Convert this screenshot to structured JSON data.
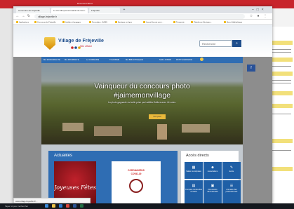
{
  "background_window": {
    "title": "Document Word",
    "side_snippets": [
      "Ensemble valorisons"
    ]
  },
  "taskbar": {
    "search_placeholder": "Taper ici pour rechercher"
  },
  "browser": {
    "tabs": [
      {
        "label": "Commune de Fréjeville"
      },
      {
        "label": "Le CC DE (Communauté de Com..."
      },
      {
        "label": "Fréjeville"
      }
    ],
    "url": "village-frejeville.fr",
    "bookmarks": [
      "Applications",
      "Commune de Fréjeville",
      "Infolab et langages",
      "Formulaire...(MSE)",
      "Boutique en ligne",
      "Accueil la mia centr...",
      "Tresorerie",
      "Plateforme Municipa...",
      "Menu Médiathèque"
    ]
  },
  "site": {
    "name": "Village de Fréjeville",
    "tagline": "Site officiel",
    "search_placeholder": "Recherche",
    "menu": [
      "MA MUNICIPALITÉ",
      "MA PROPRIÉTÉ",
      "LA COMMUNE",
      "TOURISME",
      "MA BIBLIOTHÈQUE",
      "SES LOISIRS",
      "PETITE ENFANCE"
    ],
    "hero": {
      "title": "Vainqueur du concours photo",
      "hashtag": "#jaimemonvillage",
      "text": "La photo gagnante est celle prise par Laëtitia Guilbes avec 44 votes.",
      "button": "Voir plus"
    },
    "news_title": "Actualités",
    "card1_text": "Joyeuses Fêtes",
    "card2_title": "CORONAVIRUS",
    "card2_sub": "COVID-19",
    "quick_title": "Accès directs",
    "quick": [
      {
        "label": "Salles municipales"
      },
      {
        "label": "Associations"
      },
      {
        "label": "Ecole"
      },
      {
        "label": "Comptes rendus des conseils"
      },
      {
        "label": "Documents administratifs"
      },
      {
        "label": "Annuaire des professionnels"
      }
    ]
  },
  "status_url": "www.village-frejeville.fr/..."
}
